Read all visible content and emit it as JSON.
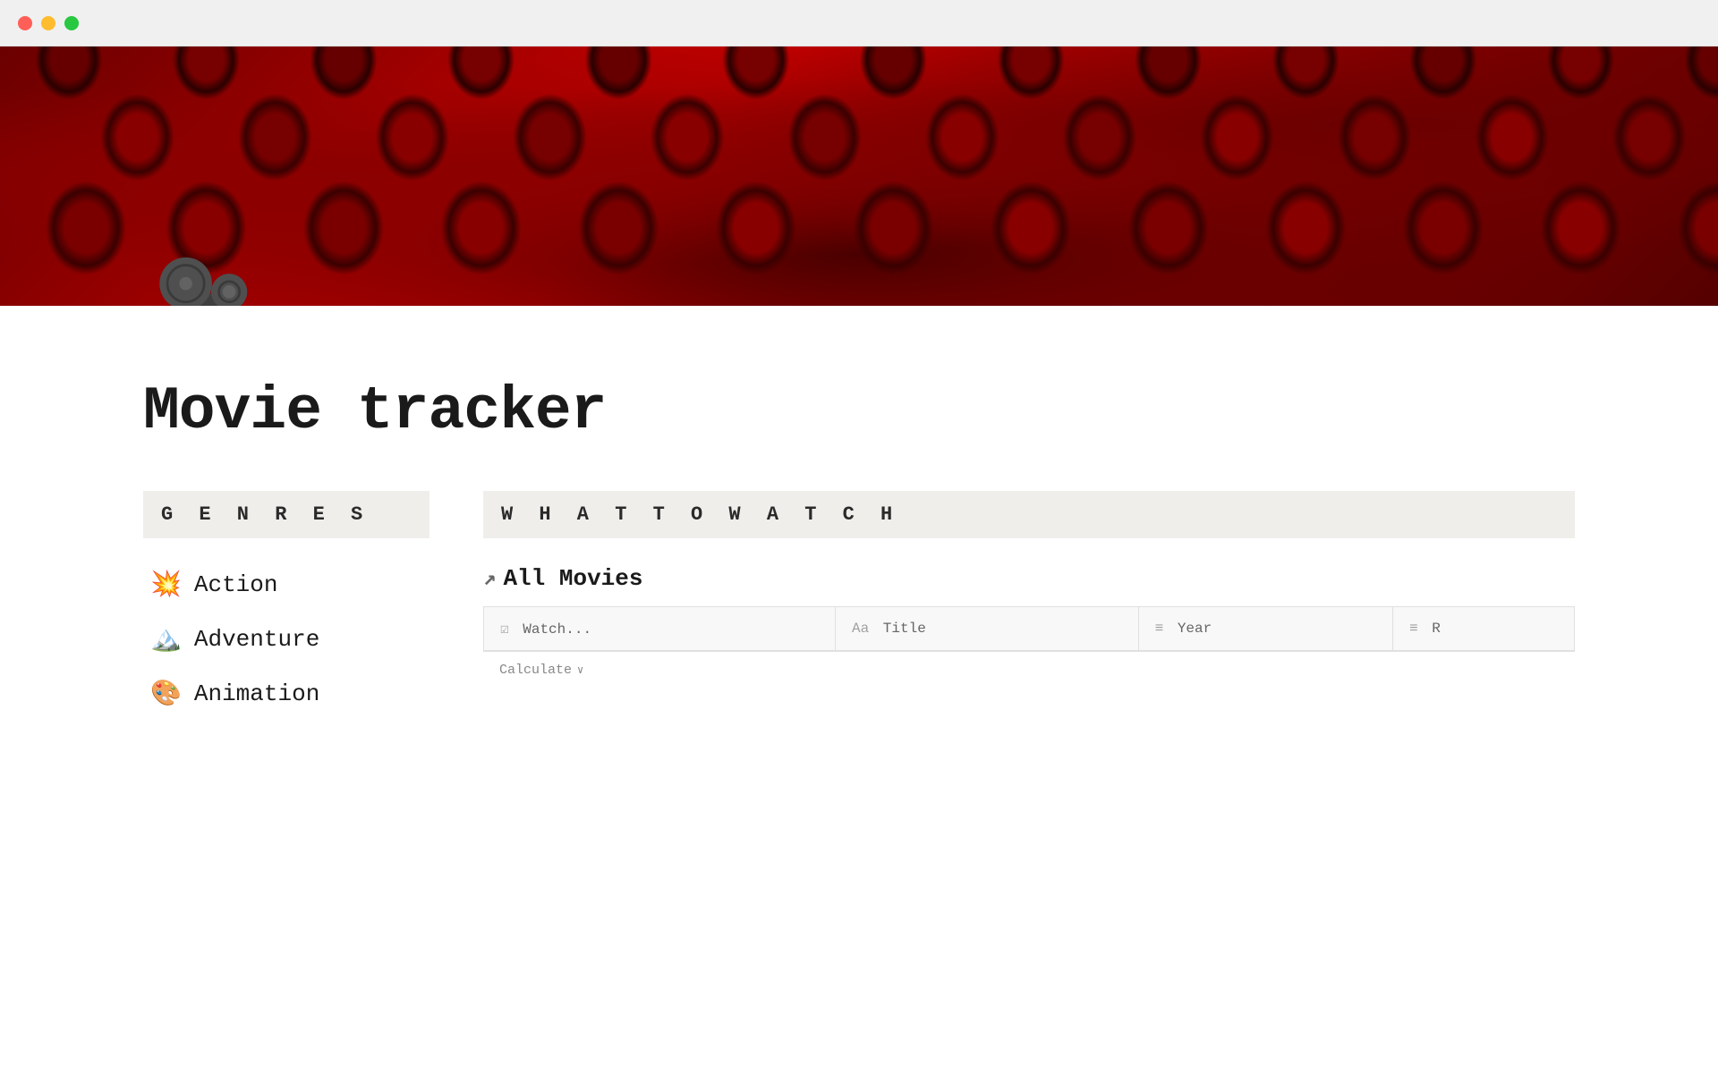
{
  "window": {
    "traffic_close": "close",
    "traffic_minimize": "minimize",
    "traffic_maximize": "maximize"
  },
  "hero": {
    "page_icon": "🎥"
  },
  "page": {
    "title": "Movie tracker"
  },
  "genres_section": {
    "header": "G E N R E S",
    "items": [
      {
        "emoji": "💥",
        "label": "Action"
      },
      {
        "emoji": "🏔️",
        "label": "Adventure"
      },
      {
        "emoji": "🎨",
        "label": "Animation"
      }
    ]
  },
  "watch_section": {
    "header": "W H A T   T O   W A T C H",
    "all_movies_label": "All Movies",
    "arrow": "↗",
    "table": {
      "columns": [
        {
          "icon": "☑",
          "label": "Watch..."
        },
        {
          "icon": "Aa",
          "label": "Title"
        },
        {
          "icon": "≡",
          "label": "Year"
        },
        {
          "icon": "≡",
          "label": "R"
        }
      ],
      "footer_label": "Calculate",
      "footer_icon": "∨"
    }
  }
}
